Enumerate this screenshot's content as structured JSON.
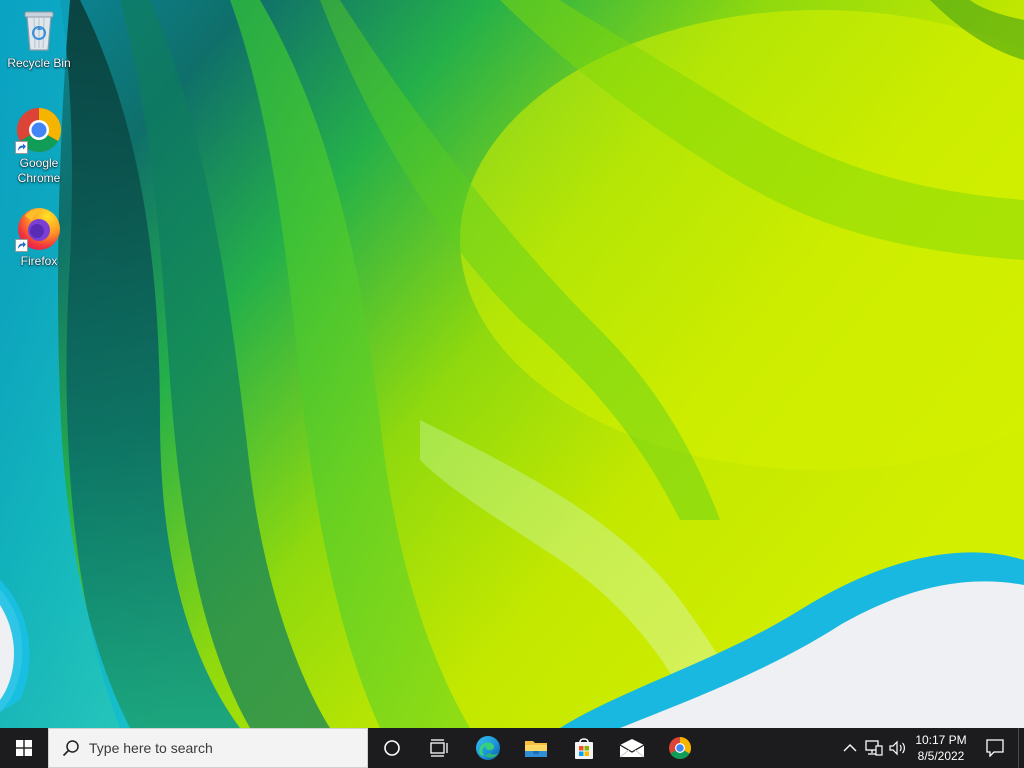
{
  "desktop": {
    "icons": [
      {
        "label": "Recycle Bin",
        "icon": "recycle-bin-icon",
        "shortcut": false
      },
      {
        "label": "Google\nChrome",
        "icon": "chrome-icon",
        "shortcut": true
      },
      {
        "label": "Firefox",
        "icon": "firefox-icon",
        "shortcut": true
      }
    ]
  },
  "taskbar": {
    "start_icon": "windows-logo-icon",
    "search_placeholder": "Type here to search",
    "pinned": [
      {
        "name": "Cortana",
        "icon": "cortana-circle-icon"
      },
      {
        "name": "Task View",
        "icon": "task-view-icon"
      },
      {
        "name": "Microsoft Edge",
        "icon": "edge-icon"
      },
      {
        "name": "File Explorer",
        "icon": "file-explorer-icon"
      },
      {
        "name": "Microsoft Store",
        "icon": "store-icon"
      },
      {
        "name": "Mail",
        "icon": "mail-icon"
      },
      {
        "name": "Google Chrome",
        "icon": "chrome-icon"
      }
    ],
    "tray": {
      "icons": [
        "chevron-up-icon",
        "network-icon",
        "volume-icon"
      ],
      "time": "10:17 PM",
      "date": "8/5/2022",
      "notification_icon": "action-center-icon"
    }
  },
  "colors": {
    "taskbar_bg": "#1c1c1e",
    "search_bg": "#f3f3f3",
    "wallpaper_lime": "#c8e600",
    "wallpaper_teal": "#0f8c8c"
  }
}
